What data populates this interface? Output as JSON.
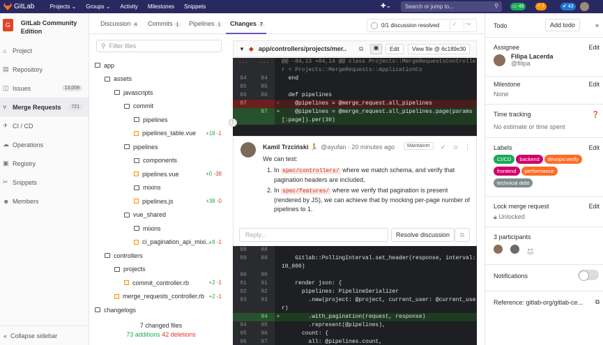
{
  "topnav": {
    "logo_text": "GitLab",
    "menu": [
      "Projects ⌄",
      "Groups ⌄",
      "Activity",
      "Milestones",
      "Snippets"
    ],
    "search_placeholder": "Search or jump to...",
    "badges": [
      "49",
      "1",
      "43"
    ]
  },
  "sidebar": {
    "project_name": "GitLab Community Edition",
    "project_initial": "G",
    "items": [
      {
        "label": "Project",
        "icon": "home-icon"
      },
      {
        "label": "Repository",
        "icon": "book-icon"
      },
      {
        "label": "Issues",
        "icon": "issues-icon",
        "count": "13,009"
      },
      {
        "label": "Merge Requests",
        "icon": "merge-request-icon",
        "count": "721"
      },
      {
        "label": "CI / CD",
        "icon": "rocket-icon"
      },
      {
        "label": "Operations",
        "icon": "cloud-gear-icon"
      },
      {
        "label": "Registry",
        "icon": "container-icon"
      },
      {
        "label": "Snippets",
        "icon": "snippet-icon"
      },
      {
        "label": "Members",
        "icon": "users-icon"
      }
    ],
    "collapse": "Collapse sidebar"
  },
  "tabs": [
    {
      "label": "Discussion",
      "count": "4"
    },
    {
      "label": "Commits",
      "count": "1"
    },
    {
      "label": "Pipelines",
      "count": "1"
    },
    {
      "label": "Changes",
      "count": "7"
    }
  ],
  "discussion_status": "0/1 discussion resolved",
  "filter_placeholder": "Filter files",
  "tree": [
    {
      "name": "app",
      "type": "dir"
    },
    {
      "name": "assets",
      "type": "dir"
    },
    {
      "name": "javascripts",
      "type": "dir"
    },
    {
      "name": "commit",
      "type": "dir"
    },
    {
      "name": "pipelines",
      "type": "dir"
    },
    {
      "name": "pipelines_table.vue",
      "type": "file",
      "add": "+18",
      "del": "-1"
    },
    {
      "name": "pipelines",
      "type": "dir"
    },
    {
      "name": "components",
      "type": "dir"
    },
    {
      "name": "pipelines.vue",
      "type": "file",
      "add": "+0",
      "del": "-38"
    },
    {
      "name": "mixins",
      "type": "dir"
    },
    {
      "name": "pipelines.js",
      "type": "file",
      "add": "+38",
      "del": "-0"
    },
    {
      "name": "vue_shared",
      "type": "dir"
    },
    {
      "name": "mixins",
      "type": "dir"
    },
    {
      "name": "ci_pagination_api_mixi...",
      "type": "file",
      "add": "+8",
      "del": "-1"
    },
    {
      "name": "controllers",
      "type": "dir"
    },
    {
      "name": "projects",
      "type": "dir"
    },
    {
      "name": "commit_controller.rb",
      "type": "file",
      "add": "+2",
      "del": "-1"
    },
    {
      "name": "merge_requests_controller.rb",
      "type": "file",
      "add": "+2",
      "del": "-1"
    },
    {
      "name": "changelogs",
      "type": "dir"
    }
  ],
  "tree_summary": {
    "files": "7 changed files",
    "additions": "73 additions",
    "deletions": "42 deletions"
  },
  "diff_file": {
    "path": "app/controllers/projects/mer...",
    "edit": "Edit",
    "view": "View file @ 6c189e30"
  },
  "code_top": [
    {
      "n1": "...",
      "n2": "...",
      "s": "",
      "t": "@@ -84,13 +84,14 @@ class Projects::MergeRequestsController < Projects::MergeRequests::ApplicationCo",
      "type": "hunk"
    },
    {
      "n1": "84",
      "n2": "84",
      "s": "",
      "t": "  end",
      "type": "ctx"
    },
    {
      "n1": "85",
      "n2": "85",
      "s": "",
      "t": "",
      "type": "ctx"
    },
    {
      "n1": "86",
      "n2": "86",
      "s": "",
      "t": "  def pipelines",
      "type": "ctx"
    },
    {
      "n1": "87",
      "n2": "",
      "s": "-",
      "t": "    @pipelines = @merge_request.all_pipelines",
      "type": "del"
    },
    {
      "n1": "",
      "n2": "87",
      "s": "+",
      "t": "    @pipelines = @merge_request.all_pipelines.page(params[:page]).per(30)",
      "type": "ins"
    }
  ],
  "comment": {
    "author": "Kamil Trzciński 🏃",
    "handle": "@ayufan",
    "time": "· 20 minutes ago",
    "role": "Maintainer",
    "intro": "We can test:",
    "items": [
      {
        "pre": "In ",
        "code": "spec/controllers/",
        "post": " where we match schema, and verify that pagination headers are included,"
      },
      {
        "pre": "In ",
        "code": "spec/features/",
        "post": " where we verify that pagination is present (rendered by JS), we can achieve that by mocking per-page number of pipelines to 1."
      }
    ],
    "reply_placeholder": "Reply...",
    "resolve": "Resolve discussion"
  },
  "code_bottom": [
    {
      "n1": "88",
      "n2": "88",
      "s": "",
      "t": "",
      "type": "ctx"
    },
    {
      "n1": "89",
      "n2": "89",
      "s": "",
      "t": "    Gitlab::PollingInterval.set_header(response, interval: 10_000)",
      "type": "ctx"
    },
    {
      "n1": "90",
      "n2": "90",
      "s": "",
      "t": "",
      "type": "ctx"
    },
    {
      "n1": "91",
      "n2": "91",
      "s": "",
      "t": "    render json: {",
      "type": "ctx"
    },
    {
      "n1": "92",
      "n2": "92",
      "s": "",
      "t": "      pipelines: PipelineSerializer",
      "type": "ctx"
    },
    {
      "n1": "93",
      "n2": "93",
      "s": "",
      "t": "        .new(project: @project, current_user: @current_user)",
      "type": "ctx"
    },
    {
      "n1": "",
      "n2": "94",
      "s": "+",
      "t": "        .with_pagination(request, response)",
      "type": "ins"
    },
    {
      "n1": "94",
      "n2": "95",
      "s": "",
      "t": "        .represent(@pipelines),",
      "type": "ctx"
    },
    {
      "n1": "95",
      "n2": "96",
      "s": "",
      "t": "      count: {",
      "type": "ctx"
    },
    {
      "n1": "96",
      "n2": "97",
      "s": "",
      "t": "        all: @pipelines.count,",
      "type": "ctx"
    }
  ],
  "right": {
    "todo": "Todo",
    "add_todo": "Add todo",
    "assignee_title": "Assignee",
    "assignee_name": "Filipa Lacerda",
    "assignee_handle": "@filipa",
    "milestone_title": "Milestone",
    "milestone_value": "None",
    "time_title": "Time tracking",
    "time_value": "No estimate or time spent",
    "labels_title": "Labels",
    "labels": [
      {
        "name": "CI/CD",
        "color": "#1aaa55"
      },
      {
        "name": "backend",
        "color": "#d10069"
      },
      {
        "name": "devops:verify",
        "color": "#fc6d26"
      },
      {
        "name": "frontend",
        "color": "#d10069"
      },
      {
        "name": "performance",
        "color": "#fc6d26"
      },
      {
        "name": "technical debt",
        "color": "#7f8c8d"
      }
    ],
    "lock_title": "Lock merge request",
    "lock_value": "Unlocked",
    "participants_title": "3 participants",
    "notifications_title": "Notifications",
    "reference": "Reference: gitlab-org/gitlab-ce...",
    "edit": "Edit"
  }
}
